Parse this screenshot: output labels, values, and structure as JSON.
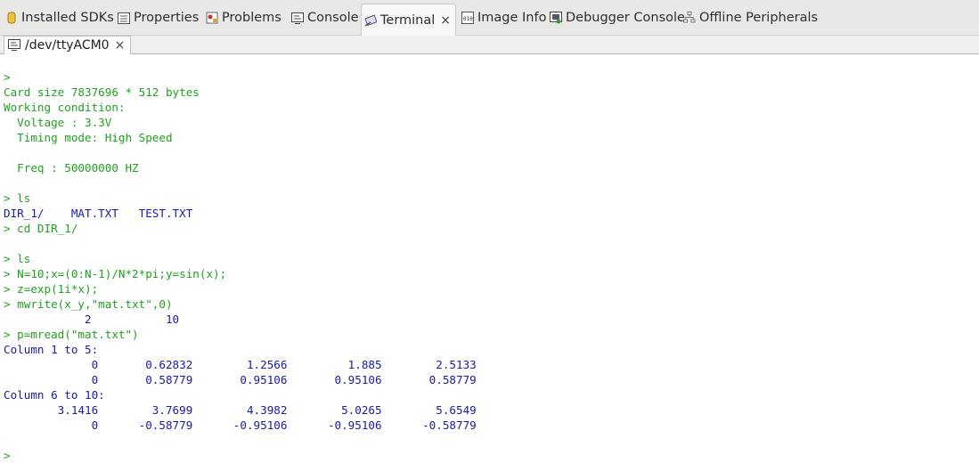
{
  "tabs": [
    {
      "label": "Installed SDKs",
      "icon": "sdk-cylinder-icon"
    },
    {
      "label": "Properties",
      "icon": "properties-icon"
    },
    {
      "label": "Problems",
      "icon": "problems-icon"
    },
    {
      "label": "Console",
      "icon": "console-icon"
    },
    {
      "label": "Terminal",
      "icon": "terminal-icon",
      "active": true,
      "close": "×"
    },
    {
      "label": "Image Info",
      "icon": "image-info-icon"
    },
    {
      "label": "Debugger Console",
      "icon": "debugger-console-icon"
    },
    {
      "label": "Offline Peripherals",
      "icon": "peripherals-icon"
    }
  ],
  "terminal_tab": {
    "label": "/dev/ttyACM0",
    "close": "×"
  },
  "lines": [
    {
      "text": ">",
      "color": "green"
    },
    {
      "text": "Card size 7837696 * 512 bytes",
      "color": "green"
    },
    {
      "text": "Working condition:",
      "color": "green"
    },
    {
      "text": "  Voltage : 3.3V",
      "color": "green"
    },
    {
      "text": "  Timing mode: High Speed",
      "color": "green"
    },
    {
      "text": "",
      "color": "green"
    },
    {
      "text": "  Freq : 50000000 HZ",
      "color": "green"
    },
    {
      "text": "",
      "color": "green"
    },
    {
      "text": "> ls",
      "color": "green"
    },
    {
      "text": "DIR_1/    MAT.TXT   TEST.TXT",
      "color": "blue"
    },
    {
      "text": "> cd DIR_1/",
      "color": "green"
    },
    {
      "text": "",
      "color": "green"
    },
    {
      "text": "> ls",
      "color": "green"
    },
    {
      "text": "> N=10;x=(0:N-1)/N*2*pi;y=sin(x);",
      "color": "green"
    },
    {
      "text": "> z=exp(1i*x);",
      "color": "green"
    },
    {
      "text": "> mwrite(x_y,\"mat.txt\",0)",
      "color": "green"
    },
    {
      "text": "            2           10",
      "color": "blue"
    },
    {
      "text": "> p=mread(\"mat.txt\")",
      "color": "green"
    },
    {
      "text": "Column 1 to 5:",
      "color": "blue"
    },
    {
      "text": "             0       0.62832        1.2566         1.885        2.5133",
      "color": "blue"
    },
    {
      "text": "             0       0.58779       0.95106       0.95106       0.58779",
      "color": "blue"
    },
    {
      "text": "Column 6 to 10:",
      "color": "blue"
    },
    {
      "text": "        3.1416        3.7699        4.3982        5.0265        5.6549",
      "color": "blue"
    },
    {
      "text": "             0      -0.58779      -0.95106      -0.95106      -0.58779",
      "color": "blue"
    },
    {
      "text": "",
      "color": "green"
    },
    {
      "text": ">",
      "color": "green"
    }
  ]
}
